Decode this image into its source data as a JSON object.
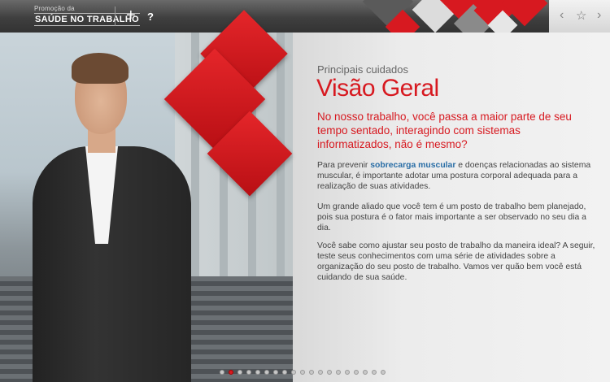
{
  "header": {
    "brand_small": "Promoção da",
    "brand_big": "SAÚDE NO TRABALHO",
    "add_icon": "+",
    "help_icon": "?",
    "prev_icon": "‹",
    "star_icon": "☆",
    "next_icon": "›"
  },
  "content": {
    "kicker": "Principais cuidados",
    "title": "Visão Geral",
    "lead": "No nosso trabalho, você passa a maior parte de seu tempo sentado, interagindo com sistemas informatizados, não é mesmo?",
    "p1_before": "Para prevenir ",
    "p1_link": "sobrecarga muscular",
    "p1_after": " e doenças relacionadas ao sistema muscular, é importante adotar uma postura corporal adequada para a realização de suas atividades.",
    "p2": "Um grande aliado que você tem é um posto de trabalho bem planejado, pois sua postura é o fator mais importante a ser observado no seu dia a dia.",
    "p3": "Você sabe como ajustar seu posto de trabalho da maneira ideal? A seguir, teste seus conhecimentos com uma série de atividades sobre a organização do seu posto de trabalho. Vamos ver quão bem você está cuidando de sua saúde."
  },
  "pager": {
    "total": 19,
    "active_index": 1
  },
  "colors": {
    "accent_red": "#d71920",
    "link_blue": "#2a6ea6"
  }
}
